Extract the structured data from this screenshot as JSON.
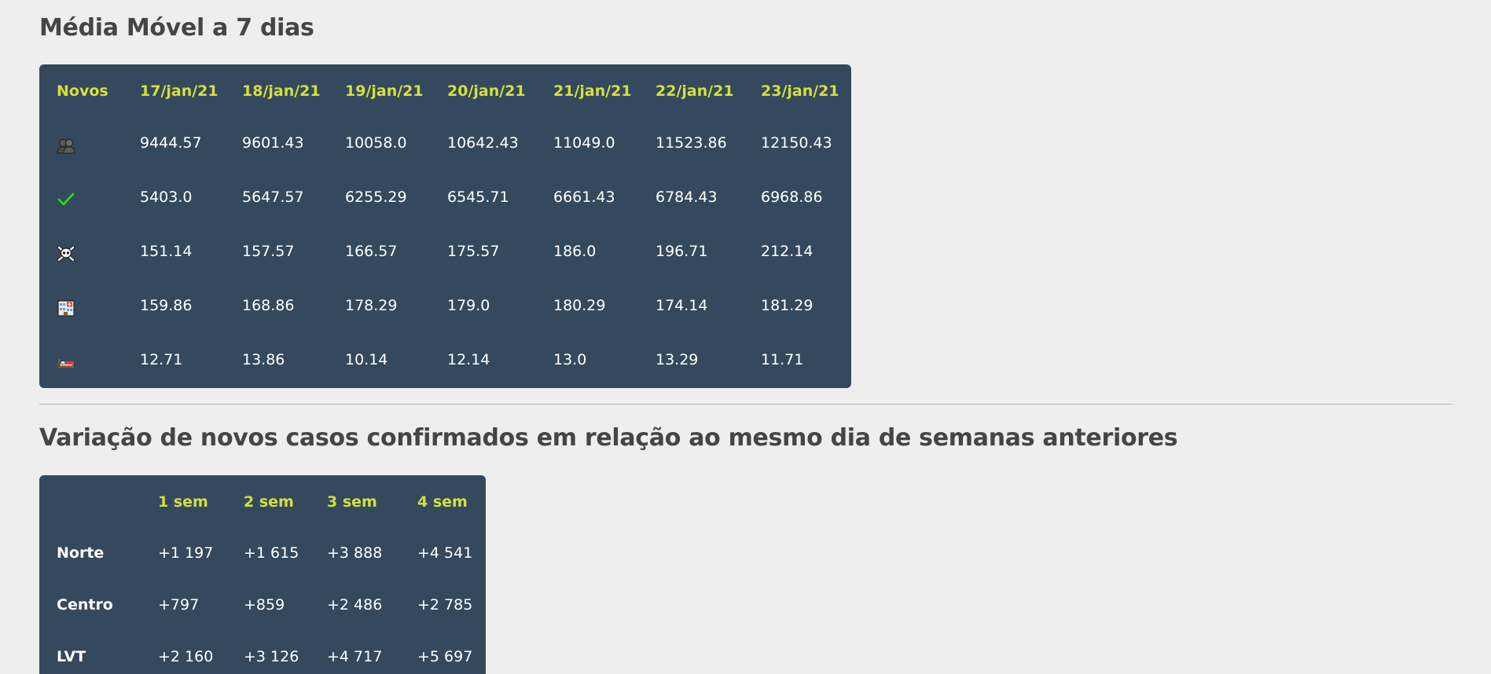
{
  "section1": {
    "title": "Média Móvel a 7 dias",
    "header_first": "Novos",
    "dates": [
      "17/jan/21",
      "18/jan/21",
      "19/jan/21",
      "20/jan/21",
      "21/jan/21",
      "22/jan/21",
      "23/jan/21"
    ],
    "rows": [
      {
        "icon": "people-icon",
        "values": [
          "9444.57",
          "9601.43",
          "10058.0",
          "10642.43",
          "11049.0",
          "11523.86",
          "12150.43"
        ]
      },
      {
        "icon": "checkmark-icon",
        "values": [
          "5403.0",
          "5647.57",
          "6255.29",
          "6545.71",
          "6661.43",
          "6784.43",
          "6968.86"
        ]
      },
      {
        "icon": "skull-crossbones-icon",
        "values": [
          "151.14",
          "157.57",
          "166.57",
          "175.57",
          "186.0",
          "196.71",
          "212.14"
        ]
      },
      {
        "icon": "hospital-icon",
        "values": [
          "159.86",
          "168.86",
          "178.29",
          "179.0",
          "180.29",
          "174.14",
          "181.29"
        ]
      },
      {
        "icon": "bed-icon",
        "values": [
          "12.71",
          "13.86",
          "10.14",
          "12.14",
          "13.0",
          "13.29",
          "11.71"
        ]
      }
    ]
  },
  "section2": {
    "title": "Variação de novos casos confirmados em relação ao mesmo dia de semanas anteriores",
    "headers": [
      "1 sem",
      "2 sem",
      "3 sem",
      "4 sem"
    ],
    "rows": [
      {
        "label": "Norte",
        "values": [
          "+1 197",
          "+1 615",
          "+3 888",
          "+4 541"
        ]
      },
      {
        "label": "Centro",
        "values": [
          "+797",
          "+859",
          "+2 486",
          "+2 785"
        ]
      },
      {
        "label": "LVT",
        "values": [
          "+2 160",
          "+3 126",
          "+4 717",
          "+5 697"
        ]
      }
    ]
  },
  "colors": {
    "background": "#eeeeee",
    "table_bg": "#34495e",
    "header_text": "#d6df3d",
    "title_text": "#454545"
  }
}
